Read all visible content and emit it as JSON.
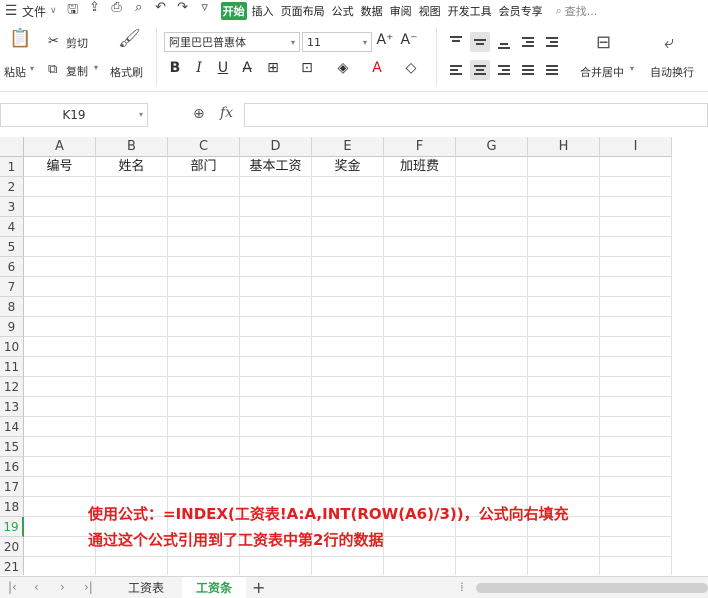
{
  "menubar": {
    "file_label": "文件",
    "tabs": [
      "开始",
      "插入",
      "页面布局",
      "公式",
      "数据",
      "审阅",
      "视图",
      "开发工具",
      "会员专享"
    ],
    "active_tab": "开始",
    "search_placeholder": "查找..."
  },
  "ribbon": {
    "paste_label": "粘贴",
    "cut_label": "剪切",
    "copy_label": "复制",
    "format_painter_label": "格式刷",
    "font_name": "阿里巴巴普惠体",
    "font_size": "11",
    "merge_label": "合并居中",
    "wrap_label": "自动换行"
  },
  "formula_bar": {
    "cell_ref": "K19",
    "fx_label": "fx",
    "formula": ""
  },
  "sheet": {
    "columns": [
      "A",
      "B",
      "C",
      "D",
      "E",
      "F",
      "G",
      "H",
      "I"
    ],
    "rows": [
      "1",
      "2",
      "3",
      "4",
      "5",
      "6",
      "7",
      "8",
      "9",
      "10",
      "11",
      "12",
      "13",
      "14",
      "15",
      "16",
      "17",
      "18",
      "19",
      "20",
      "21"
    ],
    "header_row": [
      "编号",
      "姓名",
      "部门",
      "基本工资",
      "奖金",
      "加班费"
    ],
    "selected_row": "19"
  },
  "annotation": {
    "line1": "使用公式：=INDEX(工资表!A:A,INT(ROW(A6)/3))，公式向右填充",
    "line2": "通过这个公式引用到了工资表中第2行的数据"
  },
  "sheet_tabs": {
    "tabs": [
      "工资表",
      "工资条"
    ],
    "active": "工资条"
  },
  "colors": {
    "accent": "#2fa24f",
    "annotation": "#e02020"
  }
}
